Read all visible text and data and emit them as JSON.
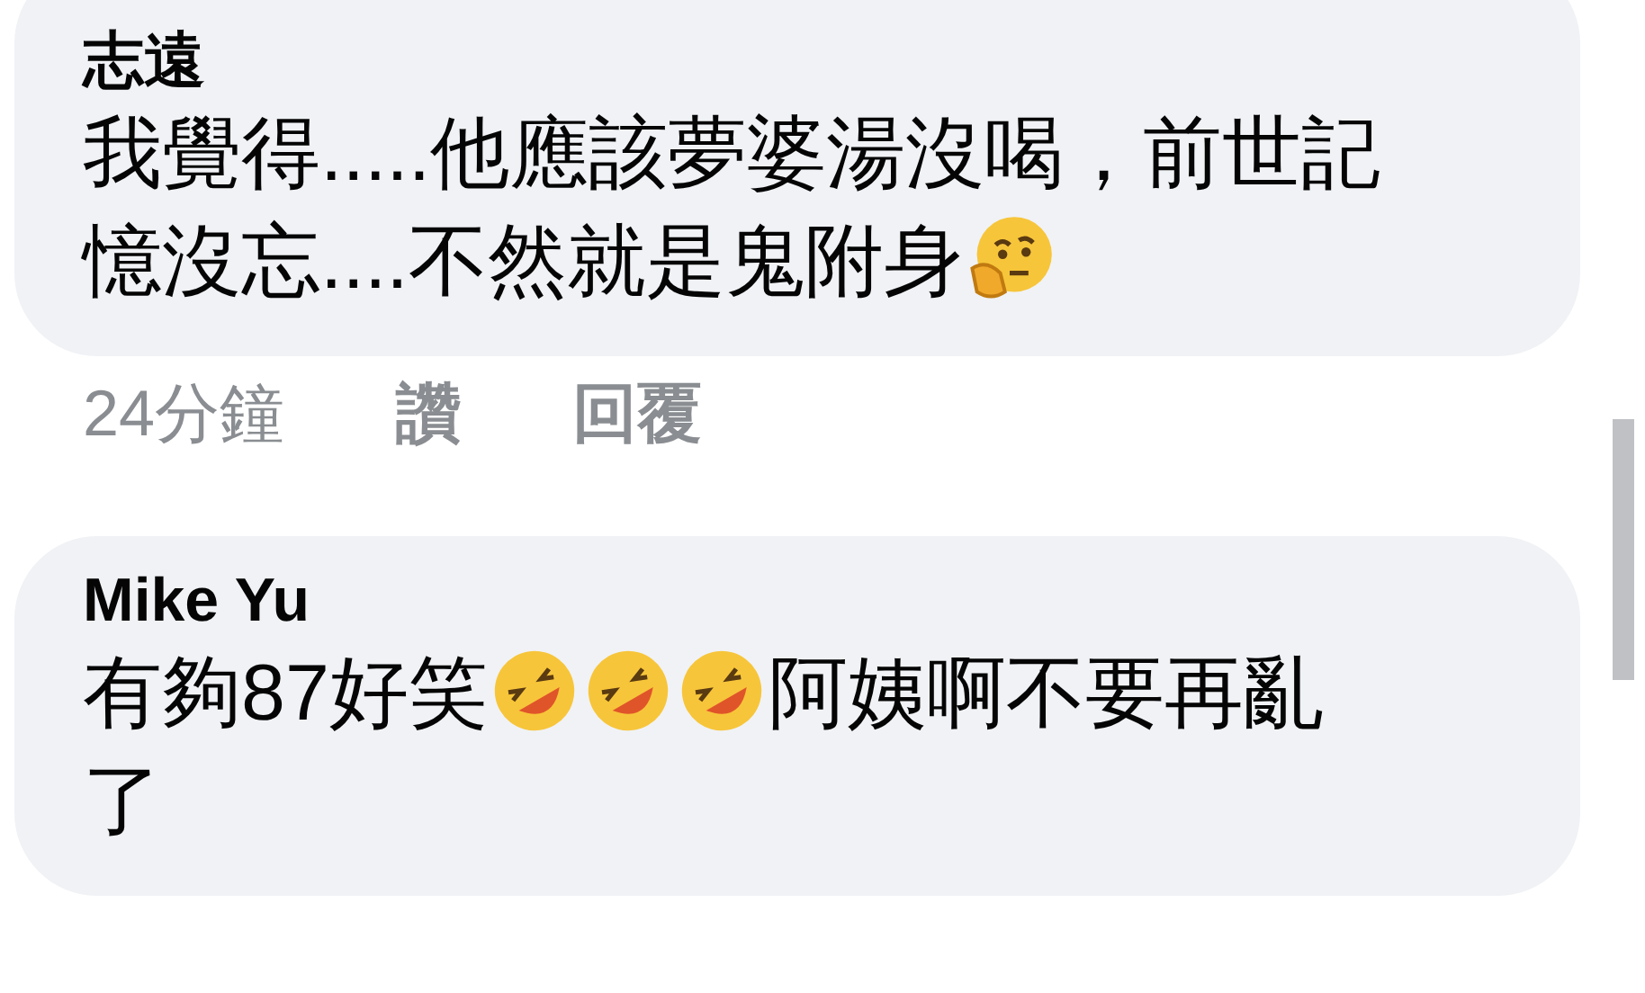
{
  "comments": [
    {
      "author": "志遠",
      "segments": [
        {
          "kind": "text",
          "text": "我覺得.....他應該夢婆湯沒喝，前世記"
        },
        {
          "kind": "line-break"
        },
        {
          "kind": "text",
          "text": "憶沒忘....不然就是鬼附身"
        },
        {
          "kind": "thinking-emoji"
        }
      ],
      "actions": [
        {
          "kind": "time",
          "label": "24分鐘"
        },
        {
          "kind": "action",
          "label": "讚"
        },
        {
          "kind": "action",
          "label": "回覆"
        }
      ]
    },
    {
      "author": "Mike Yu",
      "segments": [
        {
          "kind": "text",
          "text": "有夠87好笑"
        },
        {
          "kind": "laughing-emoji"
        },
        {
          "kind": "laughing-emoji"
        },
        {
          "kind": "laughing-emoji"
        },
        {
          "kind": "text",
          "text": "阿姨啊不要再亂"
        },
        {
          "kind": "line-break"
        },
        {
          "kind": "text",
          "text": "了"
        }
      ]
    }
  ]
}
